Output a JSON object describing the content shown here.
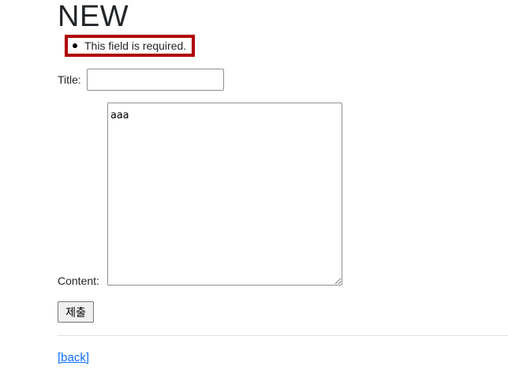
{
  "page": {
    "heading": "NEW"
  },
  "errors": {
    "items": [
      "This field is required."
    ]
  },
  "form": {
    "title_label": "Title:",
    "title_value": "",
    "content_label": "Content:",
    "content_value": "aaa",
    "submit_label": "제출"
  },
  "footer": {
    "back_link": "[back]"
  },
  "colors": {
    "error_border": "#b00000",
    "link": "#0d6efd"
  }
}
